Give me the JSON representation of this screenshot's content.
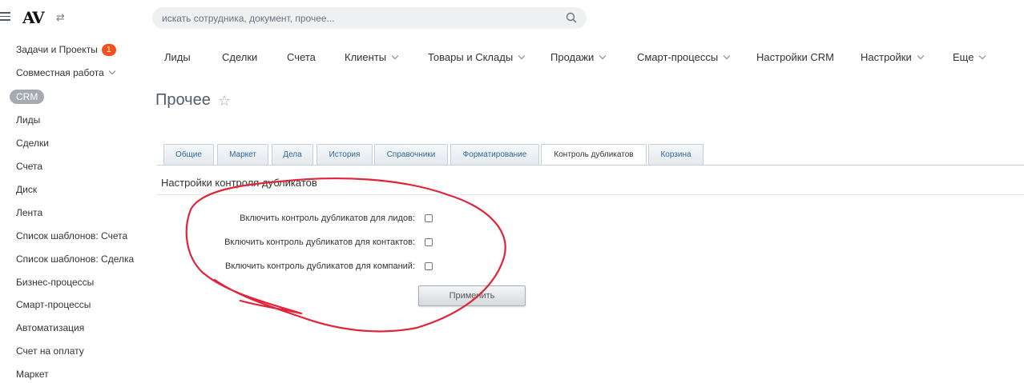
{
  "header": {
    "logo": "AV",
    "search": {
      "placeholder": "искать сотрудника, документ, прочее..."
    }
  },
  "sidebar": {
    "items": [
      {
        "label": "Задачи и Проекты",
        "badge": "1"
      },
      {
        "label": "Совместная работа"
      },
      {
        "label": "CRM"
      },
      {
        "label": "Лиды"
      },
      {
        "label": "Сделки"
      },
      {
        "label": "Счета"
      },
      {
        "label": "Диск"
      },
      {
        "label": "Лента"
      },
      {
        "label": "Список шаблонов: Счета"
      },
      {
        "label": "Список шаблонов: Сделка"
      },
      {
        "label": "Бизнес-процессы"
      },
      {
        "label": "Смарт-процессы"
      },
      {
        "label": "Автоматизация"
      },
      {
        "label": "Счет на оплату"
      },
      {
        "label": "Маркет"
      }
    ]
  },
  "topmenu": {
    "items": [
      {
        "label": "Лиды"
      },
      {
        "label": "Сделки"
      },
      {
        "label": "Счета"
      },
      {
        "label": "Клиенты"
      },
      {
        "label": "Товары и Склады"
      },
      {
        "label": "Продажи"
      },
      {
        "label": "Смарт-процессы"
      },
      {
        "label": "Настройки CRM"
      },
      {
        "label": "Настройки"
      },
      {
        "label": "Еще"
      }
    ]
  },
  "page": {
    "title": "Прочее"
  },
  "tabs": {
    "items": [
      {
        "label": "Общие"
      },
      {
        "label": "Маркет"
      },
      {
        "label": "Дела"
      },
      {
        "label": "История"
      },
      {
        "label": "Справочники"
      },
      {
        "label": "Форматирование"
      },
      {
        "label": "Контроль дубликатов"
      },
      {
        "label": "Корзина"
      }
    ],
    "active": "Контроль дубликатов"
  },
  "section": {
    "title": "Настройки контроля дубликатов",
    "options": [
      {
        "label": "Включить контроль дубликатов для лидов:",
        "checked": false
      },
      {
        "label": "Включить контроль дубликатов для контактов:",
        "checked": false
      },
      {
        "label": "Включить контроль дубликатов для компаний:",
        "checked": false
      }
    ],
    "apply_label": "Применить"
  },
  "annotation": {
    "color": "#e0243a"
  }
}
